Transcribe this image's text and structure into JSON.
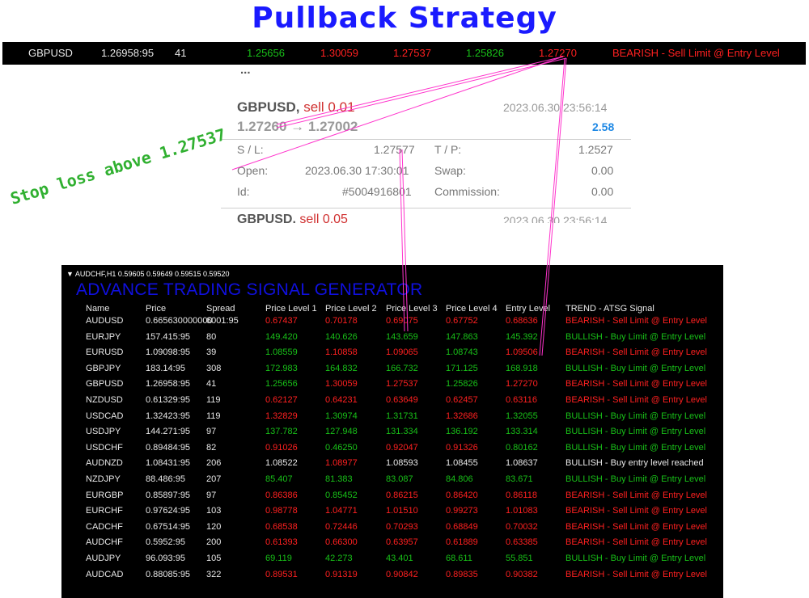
{
  "title": "Pullback Strategy",
  "top_bar": {
    "symbol": "GBPUSD",
    "price": "1.26958:95",
    "spread": "41",
    "levels": [
      "1.25656",
      "1.30059",
      "1.27537",
      "1.25826",
      "1.27270"
    ],
    "signal": "BEARISH - Sell Limit @ Entry Level"
  },
  "trade_panel": {
    "top_cut_text": "...",
    "symbol": "GBPUSD,",
    "side": "sell 0.01",
    "datetime": "2023.06.30 23:56:14",
    "prices": "1.27260 → 1.27002",
    "profit": "2.58",
    "sl_label": "S / L:",
    "sl_value": "1.27577",
    "tp_label": "T / P:",
    "tp_value": "1.2527",
    "open_label": "Open:",
    "open_value": "2023.06.30 17:30:01",
    "swap_label": "Swap:",
    "swap_value": "0.00",
    "id_label": "Id:",
    "id_value": "#5004916801",
    "commission_label": "Commission:",
    "commission_value": "0.00",
    "bottom_symbol": "GBPUSD,",
    "bottom_side": "sell 0.05",
    "bottom_datetime": "2023.06.30 23:56:14"
  },
  "stop_note": "Stop loss above 1.27537",
  "terminal": {
    "chart_header": "AUDCHF,H1  0.59605 0.59649 0.59515 0.59520",
    "app_title": "ADVANCE TRADING SIGNAL GENERATOR",
    "columns": [
      "Name",
      "Price",
      "Spread",
      "Price Level 1",
      "Price Level 2",
      "Price Level 3",
      "Price Level 4",
      "Entry Level",
      "TREND - ATSG Signal"
    ],
    "rows": [
      {
        "name": "AUDUSD",
        "price": "0.665630000000",
        "spread": "6001:95",
        "l1": "0.67437",
        "l2": "0.70178",
        "l3": "0.69075",
        "l4": "0.67752",
        "entry": "0.68636",
        "signal": "BEARISH - Sell Limit @ Entry Level",
        "color": "red"
      },
      {
        "name": "EURJPY",
        "price": "157.415:95",
        "spread": "80",
        "l1": "149.420",
        "l2": "140.626",
        "l3": "143.659",
        "l4": "147.863",
        "entry": "145.392",
        "signal": "BULLISH - Buy Limit @ Entry Level",
        "color": "green"
      },
      {
        "name": "EURUSD",
        "price": "1.09098:95",
        "spread": "39",
        "l1": "1.08559",
        "l2": "1.10858",
        "l3": "1.09065",
        "l4": "1.08743",
        "entry": "1.09506",
        "signal": "BEARISH - Sell Limit @ Entry Level",
        "color": "red",
        "l1color": "green",
        "l4color": "green"
      },
      {
        "name": "GBPJPY",
        "price": "183.14:95",
        "spread": "308",
        "l1": "172.983",
        "l2": "164.832",
        "l3": "166.732",
        "l4": "171.125",
        "entry": "168.918",
        "signal": "BULLISH - Buy Limit @ Entry Level",
        "color": "green"
      },
      {
        "name": "GBPUSD",
        "price": "1.26958:95",
        "spread": "41",
        "l1": "1.25656",
        "l2": "1.30059",
        "l3": "1.27537",
        "l4": "1.25826",
        "entry": "1.27270",
        "signal": "BEARISH - Sell Limit @ Entry Level",
        "color": "red",
        "l1color": "green",
        "l4color": "green"
      },
      {
        "name": "NZDUSD",
        "price": "0.61329:95",
        "spread": "119",
        "l1": "0.62127",
        "l2": "0.64231",
        "l3": "0.63649",
        "l4": "0.62457",
        "entry": "0.63116",
        "signal": "BEARISH - Sell Limit @ Entry Level",
        "color": "red"
      },
      {
        "name": "USDCAD",
        "price": "1.32423:95",
        "spread": "119",
        "l1": "1.32829",
        "l2": "1.30974",
        "l3": "1.31731",
        "l4": "1.32686",
        "entry": "1.32055",
        "signal": "BULLISH - Buy Limit @ Entry Level",
        "color": "green",
        "l1color": "red",
        "l4color": "red"
      },
      {
        "name": "USDJPY",
        "price": "144.271:95",
        "spread": "97",
        "l1": "137.782",
        "l2": "127.948",
        "l3": "131.334",
        "l4": "136.192",
        "entry": "133.314",
        "signal": "BULLISH - Buy Limit @ Entry Level",
        "color": "green"
      },
      {
        "name": "USDCHF",
        "price": "0.89484:95",
        "spread": "82",
        "l1": "0.91026",
        "l2": "0.46250",
        "l3": "0.92047",
        "l4": "0.91326",
        "entry": "0.80162",
        "signal": "BULLISH - Buy Limit @ Entry Level",
        "color": "green",
        "l1color": "red",
        "l3color": "red",
        "l4color": "red"
      },
      {
        "name": "AUDNZD",
        "price": "1.08431:95",
        "spread": "206",
        "l1": "1.08522",
        "l2": "1.08977",
        "l3": "1.08593",
        "l4": "1.08455",
        "entry": "1.08637",
        "signal": "BULLISH - Buy entry level reached",
        "color": "white",
        "l2color": "red"
      },
      {
        "name": "NZDJPY",
        "price": "88.486:95",
        "spread": "207",
        "l1": "85.407",
        "l2": "81.383",
        "l3": "83.087",
        "l4": "84.806",
        "entry": "83.671",
        "signal": "BULLISH - Buy Limit @ Entry Level",
        "color": "green"
      },
      {
        "name": "EURGBP",
        "price": "0.85897:95",
        "spread": "97",
        "l1": "0.86386",
        "l2": "0.85452",
        "l3": "0.86215",
        "l4": "0.86420",
        "entry": "0.86118",
        "signal": "BEARISH - Sell Limit @ Entry Level",
        "color": "red",
        "l2color": "green"
      },
      {
        "name": "EURCHF",
        "price": "0.97624:95",
        "spread": "103",
        "l1": "0.98778",
        "l2": "1.04771",
        "l3": "1.01510",
        "l4": "0.99273",
        "entry": "1.01083",
        "signal": "BEARISH - Sell Limit @ Entry Level",
        "color": "red"
      },
      {
        "name": "CADCHF",
        "price": "0.67514:95",
        "spread": "120",
        "l1": "0.68538",
        "l2": "0.72446",
        "l3": "0.70293",
        "l4": "0.68849",
        "entry": "0.70032",
        "signal": "BEARISH - Sell Limit @ Entry Level",
        "color": "red"
      },
      {
        "name": "AUDCHF",
        "price": "0.5952:95",
        "spread": "200",
        "l1": "0.61393",
        "l2": "0.66300",
        "l3": "0.63957",
        "l4": "0.61889",
        "entry": "0.63385",
        "signal": "BEARISH - Sell Limit @ Entry Level",
        "color": "red"
      },
      {
        "name": "AUDJPY",
        "price": "96.093:95",
        "spread": "105",
        "l1": "69.119",
        "l2": "42.273",
        "l3": "43.401",
        "l4": "68.611",
        "entry": "55.851",
        "signal": "BULLISH - Buy Limit @ Entry Level",
        "color": "green"
      },
      {
        "name": "AUDCAD",
        "price": "0.88085:95",
        "spread": "322",
        "l1": "0.89531",
        "l2": "0.91319",
        "l3": "0.90842",
        "l4": "0.89835",
        "entry": "0.90382",
        "signal": "BEARISH - Sell Limit @ Entry Level",
        "color": "red"
      }
    ]
  },
  "colors": {
    "title": "#1a1aff",
    "bullish": "#18c018",
    "bearish": "#ff2020",
    "annotation": "#ff33cc",
    "stop_note": "#30b030"
  }
}
